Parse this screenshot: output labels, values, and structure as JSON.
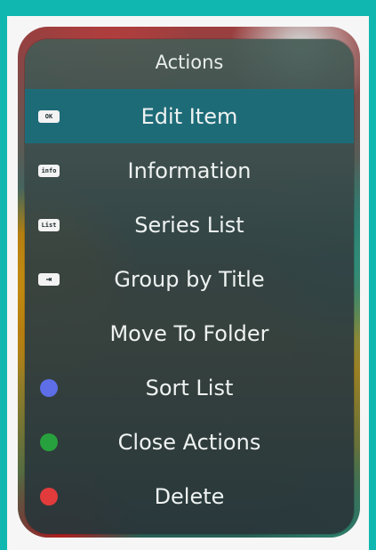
{
  "menu": {
    "title": "Actions",
    "items": [
      {
        "label": "Edit Item",
        "key_label": "OK",
        "key_type": "key",
        "selected": true
      },
      {
        "label": "Information",
        "key_label": "info",
        "key_type": "key"
      },
      {
        "label": "Series List",
        "key_label": "List",
        "key_type": "key"
      },
      {
        "label": "Group by Title",
        "key_label": "⇥",
        "key_type": "key"
      },
      {
        "label": "Move To Folder",
        "key_label": "",
        "key_type": "none"
      },
      {
        "label": "Sort List",
        "key_label": "",
        "key_type": "dot",
        "dot_color": "#5d6ee6"
      },
      {
        "label": "Close Actions",
        "key_label": "",
        "key_type": "dot",
        "dot_color": "#27a13d"
      },
      {
        "label": "Delete",
        "key_label": "",
        "key_type": "dot",
        "dot_color": "#e23b3b"
      }
    ]
  }
}
